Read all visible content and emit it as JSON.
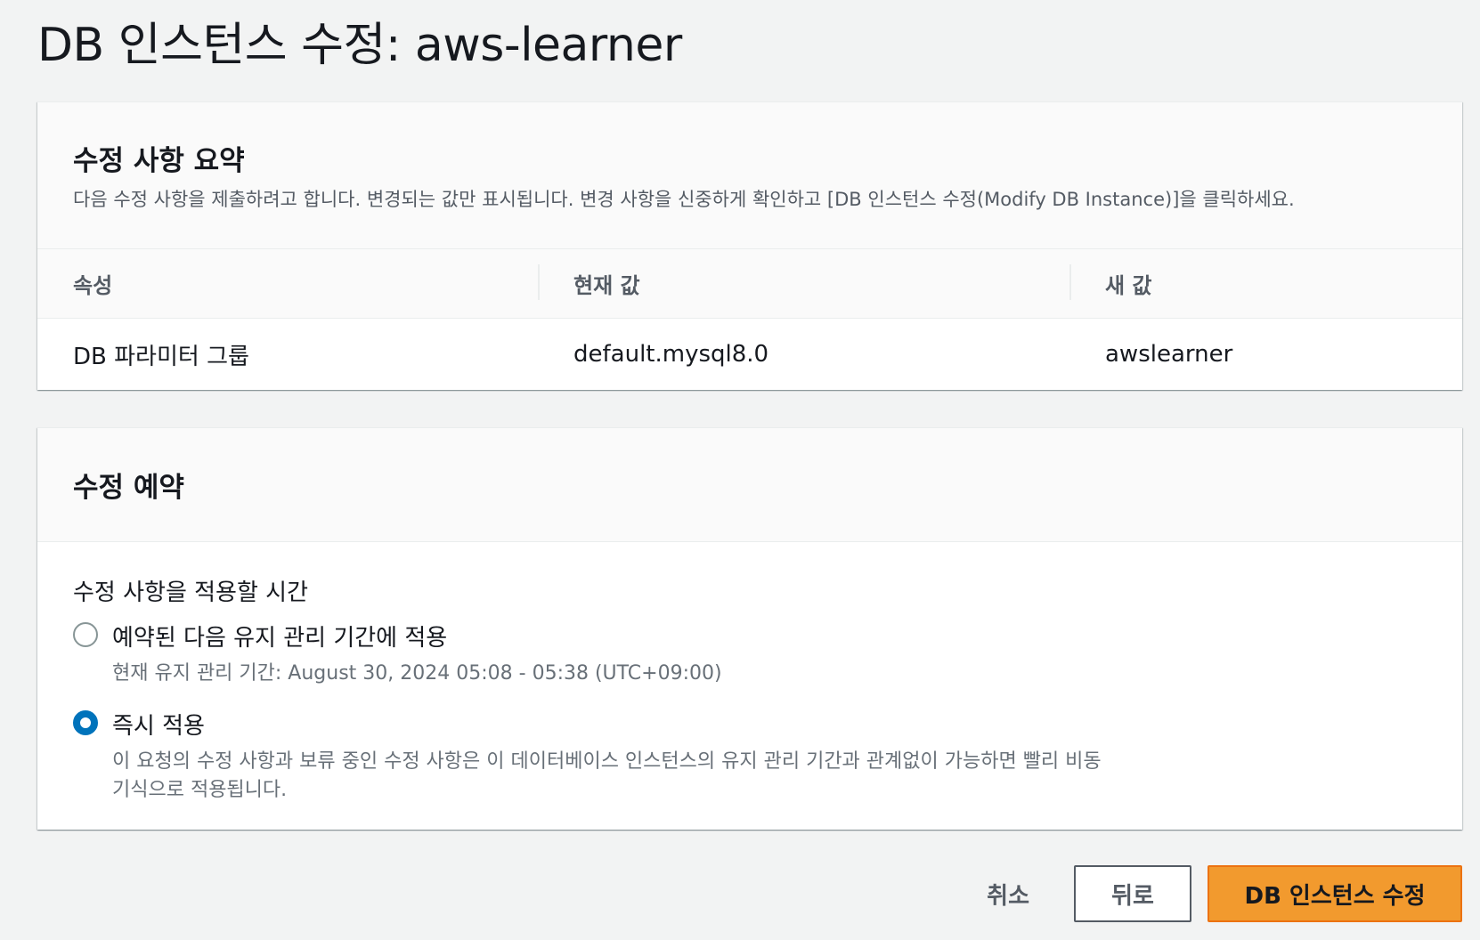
{
  "page": {
    "title": "DB 인스턴스 수정: aws-learner"
  },
  "summary": {
    "title": "수정 사항 요약",
    "description": "다음 수정 사항을 제출하려고 합니다. 변경되는 값만 표시됩니다. 변경 사항을 신중하게 확인하고 [DB 인스턴스 수정(Modify DB Instance)]을 클릭하세요.",
    "columns": [
      "속성",
      "현재 값",
      "새 값"
    ],
    "rows": [
      [
        "DB 파라미터 그룹",
        "default.mysql8.0",
        "awslearner"
      ]
    ]
  },
  "schedule": {
    "title": "수정 예약",
    "field_label": "수정 사항을 적용할 시간",
    "options": [
      {
        "label": "예약된 다음 유지 관리 기간에 적용",
        "description": "현재 유지 관리 기간: August 30, 2024 05:08 - 05:38 (UTC+09:00)",
        "selected": false
      },
      {
        "label": "즉시 적용",
        "description": "이 요청의 수정 사항과 보류 중인 수정 사항은 이 데이터베이스 인스턴스의 유지 관리 기간과 관계없이 가능하면 빨리 비동기식으로 적용됩니다.",
        "selected": true
      }
    ]
  },
  "footer": {
    "cancel_label": "취소",
    "back_label": "뒤로",
    "submit_label": "DB 인스턴스 수정"
  },
  "colors": {
    "primary_button": "#ec7211",
    "radio_selected": "#0073bb",
    "background": "#f2f3f3"
  }
}
